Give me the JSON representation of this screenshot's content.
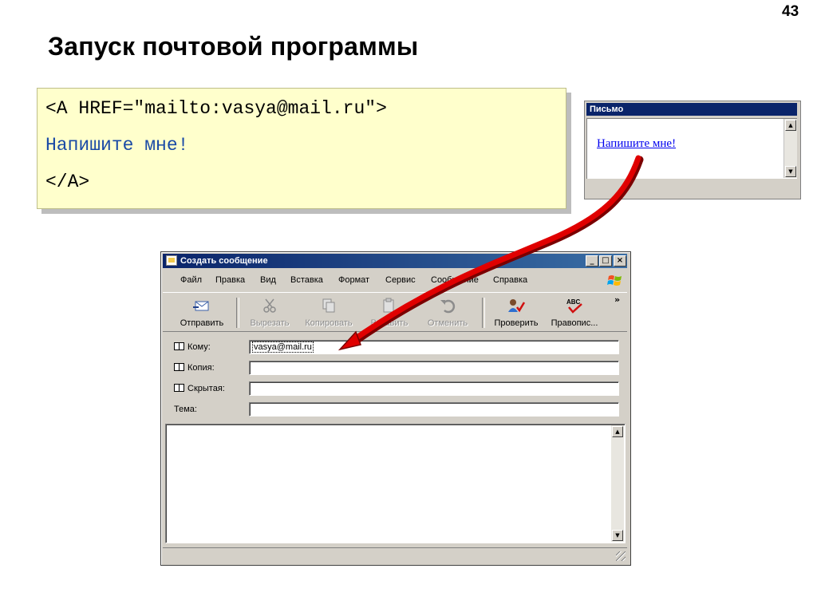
{
  "slide": {
    "number": "43",
    "title": "Запуск почтовой программы"
  },
  "code": {
    "line1": "<A HREF=\"mailto:vasya@mail.ru\">",
    "line2": "Напишите мне!",
    "line3": "</A>"
  },
  "mini_window": {
    "title": "Письмо",
    "link_text": "Напишите мне!"
  },
  "oe_window": {
    "title": "Создать сообщение",
    "controls": {
      "minimize": "_",
      "maximize": "□",
      "close": "×"
    },
    "menu": [
      "Файл",
      "Правка",
      "Вид",
      "Вставка",
      "Формат",
      "Сервис",
      "Сообщение",
      "Справка"
    ],
    "toolbar": {
      "send": "Отправить",
      "cut": "Вырезать",
      "copy": "Копировать",
      "paste": "Вставить",
      "undo": "Отменить",
      "check": "Проверить",
      "spelling": "Правопис...",
      "abc": "ABC",
      "overflow": "»"
    },
    "headers": {
      "to_label": "Кому:",
      "to_value": "vasya@mail.ru",
      "cc_label": "Копия:",
      "bcc_label": "Скрытая:",
      "subject_label": "Тема:"
    }
  },
  "colors": {
    "code_bg": "#ffffcc",
    "title_bar": "#0a246a",
    "arrow": "#e00000",
    "window_face": "#d4d0c8"
  }
}
